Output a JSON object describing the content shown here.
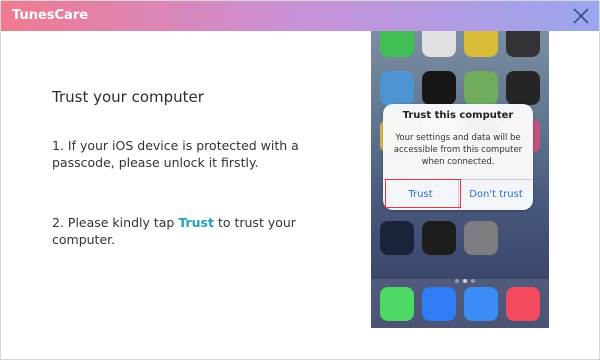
{
  "window": {
    "title": "TunesCare"
  },
  "main": {
    "heading": "Trust your computer",
    "step1": "1. If your iOS device is protected with a passcode, please unlock it firstly.",
    "step2_prefix": "2. Please kindly tap ",
    "step2_highlight": "Trust",
    "step2_suffix": " to trust your computer."
  },
  "phone": {
    "icons": [
      {
        "name": "messages-icon",
        "color": "#4cd964"
      },
      {
        "name": "calendar-icon",
        "color": "#ffffff"
      },
      {
        "name": "photos-icon",
        "color": "#f6d743"
      },
      {
        "name": "camera-icon",
        "color": "#3a3a3c"
      },
      {
        "name": "weather-icon",
        "color": "#5aa9f0"
      },
      {
        "name": "clock-icon",
        "color": "#1b1b1b"
      },
      {
        "name": "maps-icon",
        "color": "#7fc46a"
      },
      {
        "name": "videos-icon",
        "color": "#2b2b2b"
      },
      {
        "name": "notes-icon",
        "color": "#f5d54f"
      },
      {
        "name": "reminders-icon",
        "color": "#ffffff"
      },
      {
        "name": "stocks-icon",
        "color": "#1e1e1e"
      },
      {
        "name": "gamecenter-icon",
        "color": "#e35d8c"
      },
      {
        "name": "passbook-icon",
        "color": "#1d2a44"
      },
      {
        "name": "compass-icon",
        "color": "#222222"
      },
      {
        "name": "settings-icon",
        "color": "#8e8e93"
      },
      {
        "name": "phone-app-icon",
        "color": "#4cd964"
      },
      {
        "name": "mail-icon",
        "color": "#2f7cf6"
      },
      {
        "name": "safari-icon",
        "color": "#3b8cf4"
      },
      {
        "name": "music-icon",
        "color": "#f24a5f"
      }
    ],
    "dialog": {
      "title": "Trust this computer",
      "message": "Your settings and data will be accessible from this computer when connected.",
      "trust_label": "Trust",
      "dont_trust_label": "Don't trust"
    }
  }
}
